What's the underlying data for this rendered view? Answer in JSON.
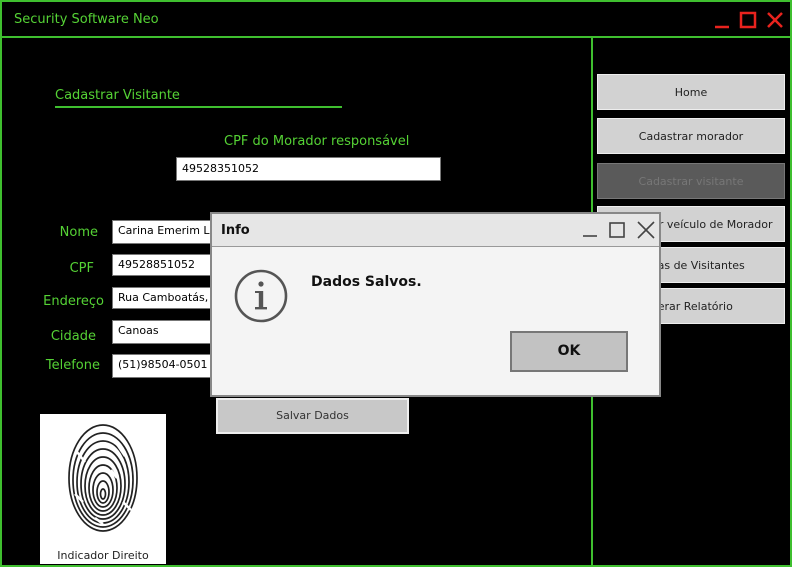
{
  "app": {
    "title": "Security Software Neo"
  },
  "form": {
    "section_title": "Cadastrar Visitante",
    "cpf_responsavel_label": "CPF do Morador responsável",
    "cpf_responsavel_value": "49528351052",
    "fields": {
      "nome": {
        "label": "Nome",
        "value": "Carina Emerim Le"
      },
      "cpf": {
        "label": "CPF",
        "value": "49528851052"
      },
      "endereco": {
        "label": "Endereço",
        "value": "Rua Camboatás, 5"
      },
      "cidade": {
        "label": "Cidade",
        "value": "Canoas"
      },
      "telefone": {
        "label": "Telefone",
        "value": "(51)98504-0501"
      }
    },
    "save_button": "Salvar Dados",
    "fingerprint_label": "Indicador Direito"
  },
  "nav": [
    {
      "label": "Home"
    },
    {
      "label": "Cadastrar morador"
    },
    {
      "label": "Cadastrar visitante"
    },
    {
      "label": "Cadastrar veículo de Morador"
    },
    {
      "label": "Vagas de Visitantes"
    },
    {
      "label": "Gerar Relatório"
    }
  ],
  "dialog": {
    "title": "Info",
    "message": "Dados Salvos.",
    "ok_label": "OK",
    "icon": "info-icon"
  },
  "colors": {
    "accent": "#3fbf2f",
    "text_green": "#55d235",
    "background": "#000000",
    "close_red": "#e8231e"
  }
}
